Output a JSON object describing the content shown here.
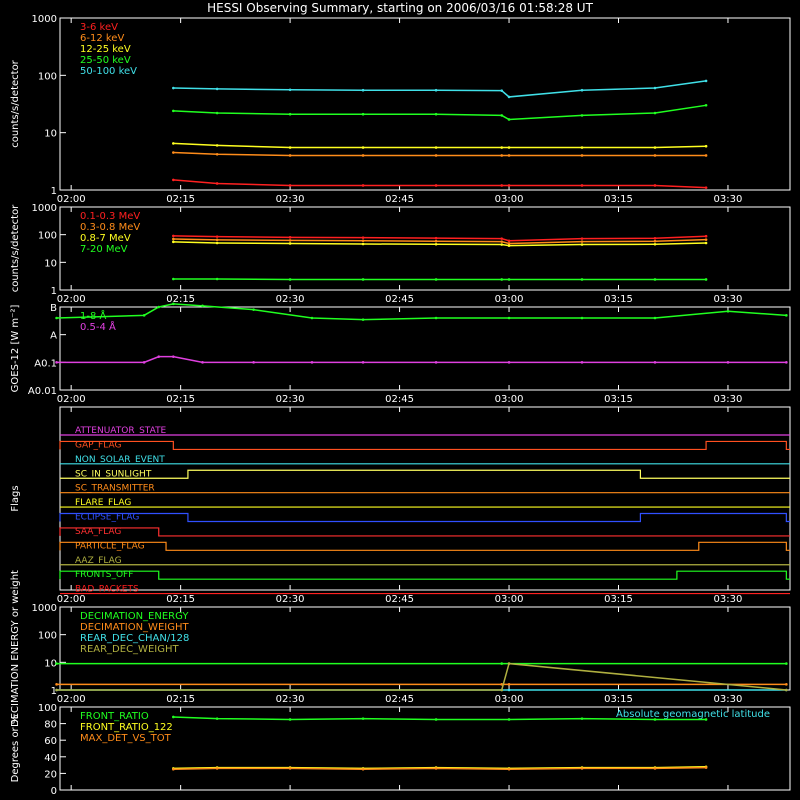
{
  "title": "HESSI Observing Summary, starting on 2006/03/16 01:58:28 UT",
  "time_ticks": [
    "02:00",
    "02:15",
    "02:30",
    "02:45",
    "03:00",
    "03:15",
    "03:30"
  ],
  "chart_data": [
    {
      "id": "lowE",
      "type": "line",
      "ylabel": "counts/s/detector",
      "yscale": "log",
      "ylim": [
        1,
        1000
      ],
      "y_ticks": [
        "1",
        "10",
        "100",
        "1000"
      ],
      "x": [
        "02:14",
        "02:20",
        "02:30",
        "02:40",
        "02:50",
        "02:59",
        "03:00",
        "03:10",
        "03:20",
        "03:27"
      ],
      "series": [
        {
          "name": "3-6 keV",
          "color": "#ff2020",
          "values": [
            1.5,
            1.3,
            1.2,
            1.2,
            1.2,
            1.2,
            1.2,
            1.2,
            1.2,
            1.1
          ]
        },
        {
          "name": "6-12 keV",
          "color": "#ff8c1a",
          "values": [
            4.5,
            4.2,
            4.0,
            4.0,
            4.0,
            4.0,
            4.0,
            4.0,
            4.0,
            4.0
          ]
        },
        {
          "name": "12-25 keV",
          "color": "#ffff20",
          "values": [
            6.5,
            6.0,
            5.5,
            5.5,
            5.5,
            5.5,
            5.5,
            5.5,
            5.5,
            5.8
          ]
        },
        {
          "name": "25-50 keV",
          "color": "#20ff20",
          "values": [
            24,
            22,
            21,
            21,
            21,
            20,
            17,
            20,
            22,
            30
          ]
        },
        {
          "name": "50-100 keV",
          "color": "#40e0e8",
          "values": [
            60,
            58,
            56,
            55,
            55,
            54,
            42,
            55,
            60,
            80
          ]
        }
      ]
    },
    {
      "id": "highE",
      "type": "line",
      "ylabel": "counts/s/detector",
      "yscale": "log",
      "ylim": [
        1,
        1000
      ],
      "y_ticks": [
        "1",
        "10",
        "100",
        "1000"
      ],
      "x": [
        "02:14",
        "02:20",
        "02:30",
        "02:40",
        "02:50",
        "02:59",
        "03:00",
        "03:10",
        "03:20",
        "03:27"
      ],
      "series": [
        {
          "name": "0.1-0.3 MeV",
          "color": "#ff2020",
          "values": [
            90,
            85,
            80,
            78,
            75,
            72,
            60,
            72,
            74,
            88
          ]
        },
        {
          "name": "0.3-0.8 MeV",
          "color": "#ff8c1a",
          "values": [
            70,
            65,
            62,
            60,
            58,
            56,
            48,
            56,
            58,
            66
          ]
        },
        {
          "name": "0.8-7 MeV",
          "color": "#ffff20",
          "values": [
            55,
            50,
            48,
            46,
            45,
            44,
            40,
            44,
            45,
            50
          ]
        },
        {
          "name": "7-20 MeV",
          "color": "#20ff20",
          "values": [
            2.5,
            2.5,
            2.4,
            2.4,
            2.4,
            2.4,
            2.4,
            2.4,
            2.4,
            2.4
          ]
        }
      ]
    },
    {
      "id": "goes",
      "type": "line",
      "ylabel": "GOES-12 [W m⁻²]",
      "yscale": "log",
      "y_ticks": [
        "A0.01",
        "A0.1",
        "A",
        "B"
      ],
      "x": [
        "01:58",
        "02:10",
        "02:12",
        "02:14",
        "02:18",
        "02:25",
        "02:33",
        "02:40",
        "02:50",
        "03:00",
        "03:10",
        "03:20",
        "03:30",
        "03:38"
      ],
      "series": [
        {
          "name": "1-8 Å",
          "color": "#20ff20",
          "values": [
            4e-08,
            5e-08,
            1e-07,
            1.3e-07,
            1.1e-07,
            8e-08,
            4e-08,
            3.5e-08,
            4e-08,
            4e-08,
            4e-08,
            4e-08,
            7e-08,
            5e-08
          ]
        },
        {
          "name": "0.5-4 Å",
          "color": "#e040e0",
          "values": [
            1e-09,
            1e-09,
            1.6e-09,
            1.6e-09,
            1e-09,
            1e-09,
            1e-09,
            1e-09,
            1e-09,
            1e-09,
            1e-09,
            1e-09,
            1e-09,
            1e-09
          ]
        }
      ]
    },
    {
      "id": "flags",
      "type": "line",
      "ylabel": "Flags",
      "flags": [
        {
          "name": "ATTENUATOR_STATE",
          "color": "#e040e0",
          "segments": []
        },
        {
          "name": "GAP_FLAG",
          "color": "#ff5020",
          "segments": [
            [
              "01:58",
              "02:14"
            ],
            [
              "03:27",
              "03:38"
            ]
          ]
        },
        {
          "name": "NON_SOLAR_EVENT",
          "color": "#40e0e8",
          "segments": []
        },
        {
          "name": "SC_IN_SUNLIGHT",
          "color": "#ffff60",
          "segments": [
            [
              "02:16",
              "03:18"
            ]
          ]
        },
        {
          "name": "SC_TRANSMITTER",
          "color": "#ff8c1a",
          "segments": []
        },
        {
          "name": "FLARE_FLAG",
          "color": "#ffff20",
          "segments": []
        },
        {
          "name": "ECLIPSE_FLAG",
          "color": "#3050ff",
          "segments": [
            [
              "01:58",
              "02:16"
            ],
            [
              "03:18",
              "03:38"
            ]
          ]
        },
        {
          "name": "SAA_FLAG",
          "color": "#ff3030",
          "segments": [
            [
              "01:58",
              "02:12"
            ]
          ]
        },
        {
          "name": "PARTICLE_FLAG",
          "color": "#ff8c1a",
          "segments": [
            [
              "01:58",
              "02:13"
            ],
            [
              "03:26",
              "03:38"
            ]
          ]
        },
        {
          "name": "AAZ_FLAG",
          "color": "#b0b040",
          "segments": []
        },
        {
          "name": "FRONTS_OFF",
          "color": "#20ff20",
          "segments": [
            [
              "01:58",
              "02:12"
            ],
            [
              "03:23",
              "03:38"
            ]
          ]
        },
        {
          "name": "BAD_PACKETS",
          "color": "#ff2020",
          "segments": []
        }
      ]
    },
    {
      "id": "decim",
      "type": "line",
      "ylabel": "DECIMATION ENERGY or weight",
      "yscale": "log",
      "ylim": [
        1,
        1000
      ],
      "y_ticks": [
        "1",
        "10",
        "100",
        "1000"
      ],
      "x": [
        "01:58",
        "02:59",
        "03:00",
        "03:38"
      ],
      "series": [
        {
          "name": "DECIMATION_ENERGY",
          "color": "#20ff20",
          "values": [
            9,
            9,
            9,
            9
          ]
        },
        {
          "name": "DECIMATION_WEIGHT",
          "color": "#ff8c1a",
          "values": [
            1.6,
            1.6,
            1.6,
            1.6
          ]
        },
        {
          "name": "REAR_DEC_CHAN/128",
          "color": "#40e0e8",
          "values": [
            1,
            1,
            1,
            1
          ]
        },
        {
          "name": "REAR_DEC_WEIGHT",
          "color": "#b0b040",
          "values": [
            1,
            1,
            9,
            1
          ]
        }
      ]
    },
    {
      "id": "ratio",
      "type": "line",
      "ylabel": "Degrees or %",
      "ylim": [
        0,
        100
      ],
      "y_ticks": [
        "0",
        "20",
        "40",
        "60",
        "80",
        "100"
      ],
      "annotation": "Absolute geomagnetic latitude",
      "x": [
        "02:14",
        "02:20",
        "02:30",
        "02:40",
        "02:50",
        "03:00",
        "03:10",
        "03:20",
        "03:27"
      ],
      "series": [
        {
          "name": "FRONT_RATIO",
          "color": "#20ff20",
          "values": [
            88,
            86,
            85,
            86,
            85,
            85,
            86,
            85,
            85
          ]
        },
        {
          "name": "FRONT_RATIO_122",
          "color": "#ffff20",
          "values": [
            26,
            27,
            27,
            26,
            27,
            26,
            27,
            27,
            28
          ]
        },
        {
          "name": "MAX_DET_VS_TOT",
          "color": "#ff8c1a",
          "values": [
            25,
            26,
            26,
            25,
            26,
            25,
            26,
            26,
            27
          ]
        },
        {
          "name": "Absolute geomagnetic latitude",
          "color": "#40e0e8",
          "values": []
        }
      ]
    }
  ]
}
